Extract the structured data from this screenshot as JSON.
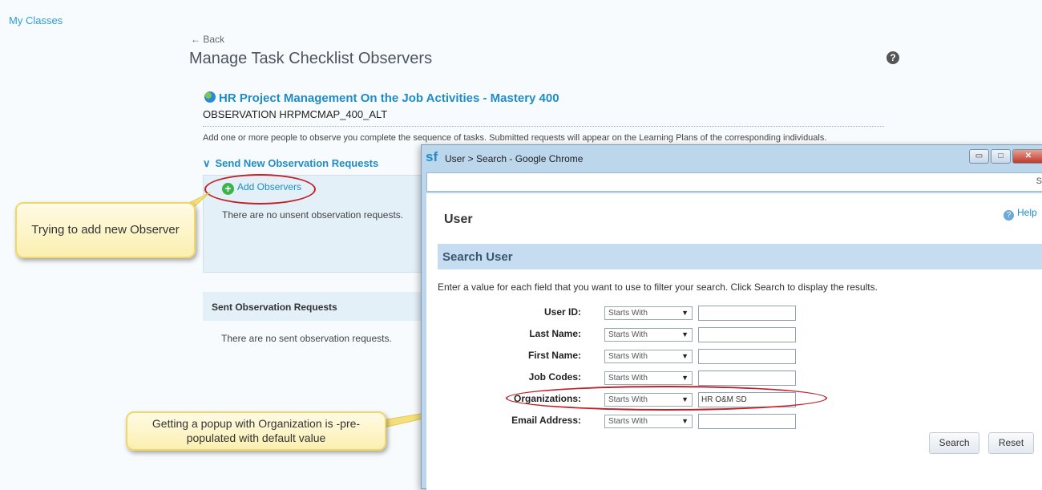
{
  "nav": {
    "my_classes": "My Classes",
    "back": "← Back"
  },
  "page": {
    "title": "Manage Task Checklist Observers",
    "help_icon": "?",
    "course_title": "HR Project Management On the Job Activities - Mastery 400",
    "observation_code": "OBSERVATION HRPMCMAP_400_ALT",
    "description": "Add one or more people to observe you complete the sequence of tasks. Submitted requests will appear on the Learning Plans of the corresponding individuals."
  },
  "send_section": {
    "header": "Send New Observation Requests",
    "add_observers": "Add Observers",
    "empty_text": "There are no unsent observation requests."
  },
  "sent_section": {
    "header": "Sent Observation Requests",
    "empty_text": "There are no sent observation requests."
  },
  "callouts": {
    "observer": "Trying to add new Observer",
    "popup": "Getting a popup with Organization is -pre-populated with default value"
  },
  "popup": {
    "logo": "sf",
    "window_title": "User > Search - Google Chrome",
    "window_controls": [
      "▭",
      "□",
      "✕"
    ],
    "address_tail": "S",
    "heading": "User",
    "help_link": "Help",
    "band_title": "Search User",
    "instructions": "Enter a value for each field that you want to use to filter your search. Click Search to display the results.",
    "fields": [
      {
        "label": "User ID:",
        "operator": "Starts With",
        "value": ""
      },
      {
        "label": "Last Name:",
        "operator": "Starts With",
        "value": ""
      },
      {
        "label": "First Name:",
        "operator": "Starts With",
        "value": ""
      },
      {
        "label": "Job Codes:",
        "operator": "Starts With",
        "value": ""
      },
      {
        "label": "Organizations:",
        "operator": "Starts With",
        "value": "HR O&M SD"
      },
      {
        "label": "Email Address:",
        "operator": "Starts With",
        "value": ""
      }
    ],
    "search_button": "Search",
    "reset_button": "Reset"
  },
  "colors": {
    "accent": "#1e8cc7",
    "highlight": "#c0202a",
    "callout": "#fbefb0"
  }
}
